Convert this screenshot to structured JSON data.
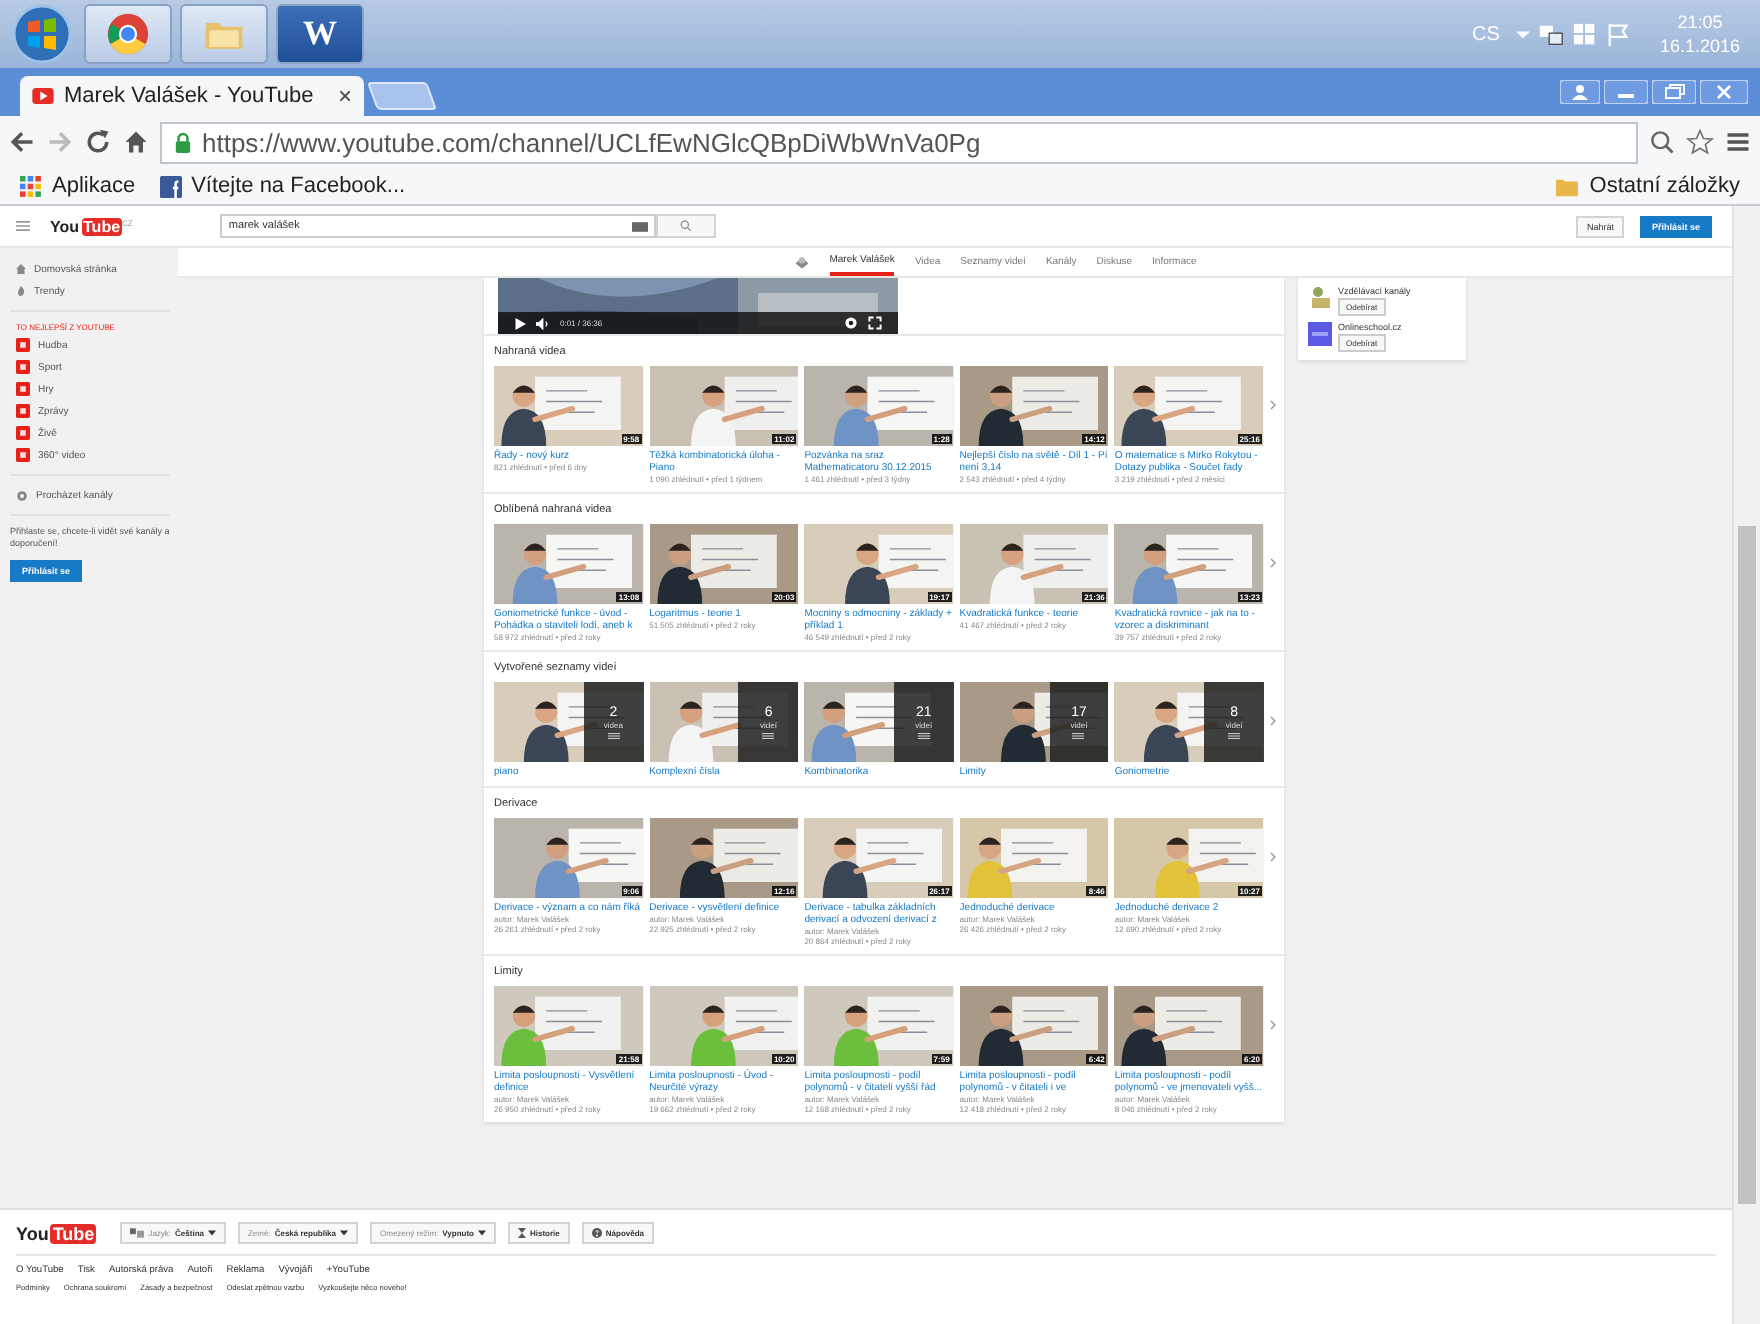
{
  "taskbar": {
    "word_logo": "W",
    "language": "CS",
    "time": "21:05",
    "date": "16.1.2016"
  },
  "browser": {
    "tab_title": "Marek Valášek - YouTube",
    "tab_close": "×",
    "url": "https://www.youtube.com/channel/UCLfEwNGlcQBpDiWbWnVa0Pg",
    "bookmarks": [
      "Aplikace",
      "Vítejte na Facebook..."
    ],
    "other_bookmarks": "Ostatní záložky"
  },
  "youtube": {
    "logo": {
      "you": "You",
      "tube": "Tube",
      "region": "CZ"
    },
    "search": {
      "value": "marek valášek"
    },
    "upload": "Nahrát",
    "sign_in": "Přihlásit se"
  },
  "sidebar": {
    "items": [
      {
        "label": "Domovská stránka",
        "kind": "home"
      },
      {
        "label": "Trendy",
        "kind": "trending"
      }
    ],
    "best_heading": "TO NEJLEPŠÍ Z YOUTUBE",
    "best": [
      "Hudba",
      "Sport",
      "Hry",
      "Zprávy",
      "Živě",
      "360° video"
    ],
    "browse": "Procházet kanály",
    "sign_in_prompt": "Přihlaste se, chcete-li vidět své kanály a doporučení!",
    "sign_in_button": "Přihlásit se"
  },
  "channel_nav": {
    "tabs": [
      {
        "label": "Marek Valášek",
        "selected": true
      },
      {
        "label": "Videa",
        "selected": false
      },
      {
        "label": "Seznamy videí",
        "selected": false
      },
      {
        "label": "Kanály",
        "selected": false
      },
      {
        "label": "Diskuse",
        "selected": false
      },
      {
        "label": "Informace",
        "selected": false
      }
    ]
  },
  "player": {
    "time": "0:01 / 36:36"
  },
  "sections": [
    {
      "title": "Nahraná videa",
      "kind": "videos",
      "items": [
        {
          "title": "Řady - nový kurz",
          "meta": "821 zhlédnutí • před 6 dny",
          "duration": "9:58"
        },
        {
          "title": "Těžká kombinatorická úloha - Piano",
          "meta": "1 090 zhlédnutí • před 1 týdnem",
          "duration": "11:02"
        },
        {
          "title": "Pozvánka na sraz Mathematicatoru 30.12.2015",
          "meta": "1 461 zhlédnutí • před 3 týdny",
          "duration": "1:28"
        },
        {
          "title": "Nejlepší číslo na světě - Díl 1 - Pí není 3,14",
          "meta": "2 543 zhlédnutí • před 4 týdny",
          "duration": "14:12"
        },
        {
          "title": "O matematice s Mirko Rokytou - Dotazy publika - Součet řady",
          "meta": "3 219 zhlédnutí • před 2 měsíci",
          "duration": "25:16"
        }
      ]
    },
    {
      "title": "Oblíbená nahraná videa",
      "kind": "videos",
      "items": [
        {
          "title": "Goniometrické funkce - úvod - Pohádka o staviteli lodí, aneb k",
          "meta": "58 972 zhlédnutí • před 2 roky",
          "duration": "13:08"
        },
        {
          "title": "Logaritmus - teorie 1",
          "meta": "51 505 zhlédnutí • před 2 roky",
          "duration": "20:03"
        },
        {
          "title": "Mocniny s odmocniny - základy + příklad 1",
          "meta": "46 549 zhlédnutí • před 2 roky",
          "duration": "19:17"
        },
        {
          "title": "Kvadratická funkce - teorie",
          "meta": "41 467 zhlédnutí • před 2 roky",
          "duration": "21:36"
        },
        {
          "title": "Kvadratická rovnice - jak na to - vzorec a diskriminant",
          "meta": "39 757 zhlédnutí • před 2 roky",
          "duration": "13:23"
        }
      ]
    },
    {
      "title": "Vytvořené seznamy videí",
      "kind": "playlists",
      "items": [
        {
          "title": "piano",
          "count": "2",
          "unit": "videa"
        },
        {
          "title": "Komplexní čísla",
          "count": "6",
          "unit": "videí"
        },
        {
          "title": "Kombinatorika",
          "count": "21",
          "unit": "videí"
        },
        {
          "title": "Limity",
          "count": "17",
          "unit": "videí"
        },
        {
          "title": "Goniometrie",
          "count": "8",
          "unit": "videí"
        }
      ]
    },
    {
      "title": "Derivace",
      "kind": "videos",
      "items": [
        {
          "title": "Derivace - význam a co nám říká",
          "author": "autor: Marek Valášek",
          "meta": "26 261 zhlédnutí • před 2 roky",
          "duration": "9:06"
        },
        {
          "title": "Derivace - vysvětlení definice",
          "author": "autor: Marek Valášek",
          "meta": "22 925 zhlédnutí • před 2 roky",
          "duration": "12:16"
        },
        {
          "title": "Derivace - tabulka základních derivací a odvození derivací z",
          "author": "autor: Marek Valášek",
          "meta": "20 864 zhlédnutí • před 2 roky",
          "duration": "26:17"
        },
        {
          "title": "Jednoduché derivace",
          "author": "autor: Marek Valášek",
          "meta": "26 426 zhlédnutí • před 2 roky",
          "duration": "8:46"
        },
        {
          "title": "Jednoduché derivace 2",
          "author": "autor: Marek Valášek",
          "meta": "12 690 zhlédnutí • před 2 roky",
          "duration": "10:27"
        }
      ]
    },
    {
      "title": "Limity",
      "kind": "videos",
      "items": [
        {
          "title": "Limita posloupnosti - Vysvětlení definice",
          "author": "autor: Marek Valášek",
          "meta": "26 950 zhlédnutí • před 2 roky",
          "duration": "21:58"
        },
        {
          "title": "Limita posloupnosti - Úvod - Neurčité výrazy",
          "author": "autor: Marek Valášek",
          "meta": "19 662 zhlédnutí • před 2 roky",
          "duration": "10:20"
        },
        {
          "title": "Limita posloupnosti - podíl polynomů - v čitateli vyšší řád",
          "author": "autor: Marek Valášek",
          "meta": "12 168 zhlédnutí • před 2 roky",
          "duration": "7:59"
        },
        {
          "title": "Limita posloupnosti - podíl polynomů - v čitateli i ve",
          "author": "autor: Marek Valášek",
          "meta": "12 418 zhlédnutí • před 2 roky",
          "duration": "6:42"
        },
        {
          "title": "Limita posloupnosti - podíl polynomů - ve jmenovateli vyšš...",
          "author": "autor: Marek Valášek",
          "meta": "8 046 zhlédnutí • před 2 roky",
          "duration": "6:20"
        }
      ]
    }
  ],
  "subscriptions": [
    {
      "name": "Vzdělávací kanály",
      "button": "Odebírat"
    },
    {
      "name": "Onlineschool.cz",
      "button": "Odebírat"
    }
  ],
  "footer": {
    "logo": {
      "you": "You",
      "tube": "Tube"
    },
    "selectors": [
      {
        "label": "Jazyk:",
        "value": "Čeština"
      },
      {
        "label": "Země:",
        "value": "Česká republika"
      },
      {
        "label": "Omezený režim:",
        "value": "Vypnuto"
      }
    ],
    "history": "Historie",
    "help": "Nápověda",
    "links": [
      "O YouTube",
      "Tisk",
      "Autorská práva",
      "Autoři",
      "Reklama",
      "Vývojáři",
      "+YouTube"
    ],
    "links_secondary": [
      "Podmínky",
      "Ochrana soukromí",
      "Zásady a bezpečnost",
      "Odeslat zpětnou vazbu",
      "Vyzkoušejte něco nového!"
    ]
  }
}
